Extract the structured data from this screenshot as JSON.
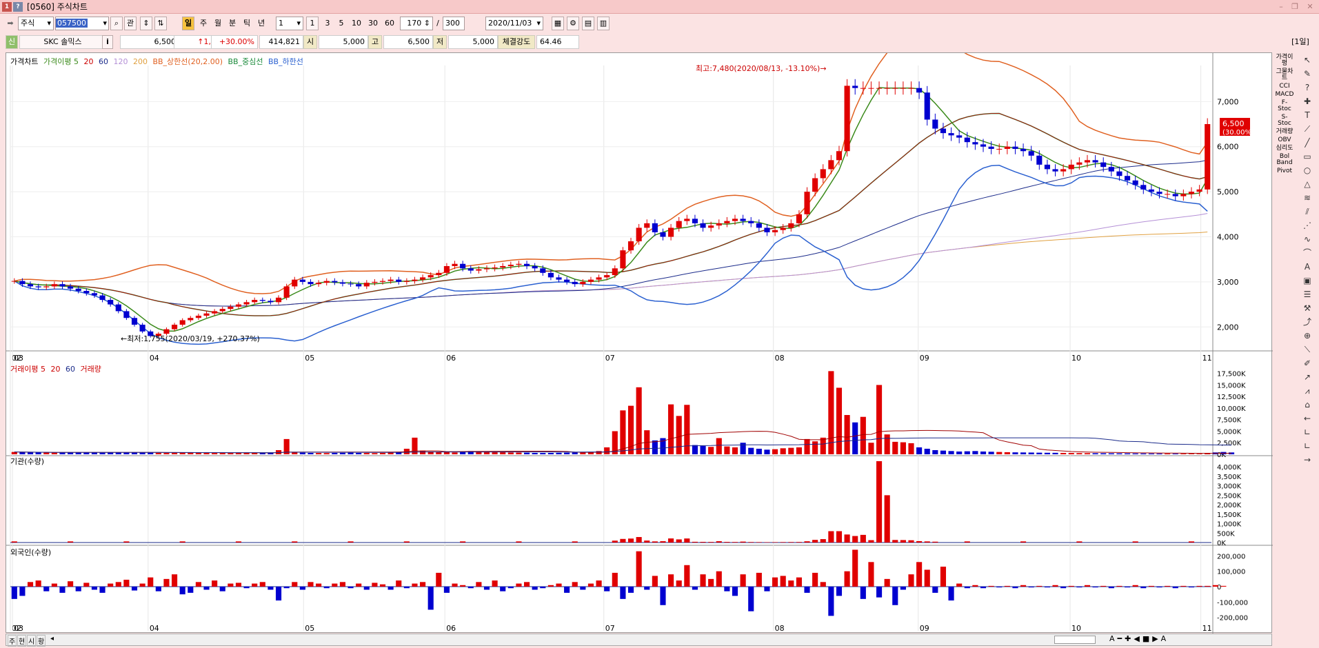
{
  "window": {
    "title": "[0560] 주식차트",
    "min": "–",
    "restore": "❐",
    "close": "✕"
  },
  "toolbar": {
    "market": "주식",
    "code": "057500",
    "gwan": "관",
    "search_icon": "magnifier-icon",
    "periods": [
      "일",
      "주",
      "월",
      "분",
      "틱",
      "년"
    ],
    "period_count": "1",
    "nums": [
      "1",
      "3",
      "5",
      "10",
      "30",
      "60"
    ],
    "display_count": "170",
    "total_count": "300",
    "date": "2020/11/03"
  },
  "quote": {
    "tag": "신",
    "name": "SKC 솔믹스",
    "info": "i",
    "price": "6,500",
    "change": "↑1,500",
    "rate": "+30.00%",
    "volume": "414,821",
    "open_label": "시",
    "open": "5,000",
    "high_label": "고",
    "high": "6,500",
    "low_label": "저",
    "low": "5,000",
    "strength_label": "체결강도",
    "strength": "64.46",
    "frame": "[1일]"
  },
  "legends": {
    "price": [
      "가격차트",
      "가격이평 5",
      "20",
      "60",
      "120",
      "200",
      "BB_상한선(20,2.00)",
      "BB_중심선",
      "BB_하한선"
    ],
    "volume": [
      "거래이평 5",
      "20",
      "60",
      "거래량"
    ],
    "inst": "기관(수량)",
    "foreign": "외국인(수량)"
  },
  "annotations": {
    "high": "최고:7,480(2020/08/13, -13.10%)",
    "low": "최저:1,755(2020/03/19, +270.37%)",
    "last_price": "6,500",
    "last_rate": "(30.00%)"
  },
  "chart_data": {
    "type": "candlestick",
    "x_ticks": [
      "02",
      "03",
      "04",
      "05",
      "06",
      "07",
      "08",
      "09",
      "10",
      "11"
    ],
    "price_axis": [
      "7,000",
      "6,000",
      "5,000",
      "4,000",
      "3,000",
      "2,000"
    ],
    "volume_axis": [
      "17,500K",
      "15,000K",
      "12,500K",
      "10,000K",
      "7,500K",
      "5,000K",
      "2,500K",
      "0K"
    ],
    "inst_axis": [
      "4,000K",
      "3,500K",
      "3,000K",
      "2,500K",
      "2,000K",
      "1,500K",
      "1,000K",
      "500K",
      "0K"
    ],
    "foreign_axis": [
      "200,000",
      "100,000",
      "0",
      "-100,000",
      "-200,000"
    ],
    "ylim_price": [
      1500,
      7800
    ],
    "closes": [
      3020,
      2950,
      2900,
      2880,
      2900,
      2950,
      2900,
      2850,
      2800,
      2750,
      2700,
      2600,
      2500,
      2350,
      2200,
      2050,
      1900,
      1800,
      1850,
      1950,
      2050,
      2150,
      2200,
      2250,
      2300,
      2350,
      2400,
      2450,
      2500,
      2550,
      2600,
      2580,
      2550,
      2650,
      2900,
      3050,
      3000,
      2950,
      2980,
      3020,
      2990,
      2960,
      2950,
      2900,
      2980,
      3000,
      3020,
      3050,
      3000,
      3020,
      3050,
      3100,
      3150,
      3200,
      3350,
      3400,
      3300,
      3250,
      3280,
      3300,
      3320,
      3350,
      3380,
      3400,
      3350,
      3300,
      3200,
      3100,
      3050,
      3000,
      2950,
      3000,
      3050,
      3100,
      3150,
      3300,
      3700,
      3900,
      4200,
      4300,
      4100,
      4000,
      4200,
      4350,
      4400,
      4300,
      4200,
      4250,
      4300,
      4350,
      4400,
      4350,
      4300,
      4200,
      4100,
      4150,
      4200,
      4300,
      4500,
      5000,
      5300,
      5500,
      5700,
      5900,
      7350,
      7300,
      7300,
      7300,
      7300,
      7300,
      7300,
      7300,
      7300,
      7200,
      6600,
      6400,
      6300,
      6250,
      6200,
      6100,
      6050,
      6000,
      5950,
      5950,
      6000,
      5950,
      5900,
      5800,
      5600,
      5500,
      5450,
      5500,
      5600,
      5650,
      5700,
      5650,
      5550,
      5450,
      5350,
      5250,
      5150,
      5050,
      5000,
      4950,
      4950,
      4900,
      4950,
      5000,
      5050,
      6500
    ],
    "volumes": [
      500,
      450,
      420,
      400,
      380,
      350,
      400,
      420,
      450,
      400,
      380,
      350,
      400,
      380,
      420,
      400,
      380,
      350,
      300,
      280,
      300,
      320,
      350,
      300,
      280,
      270,
      260,
      250,
      260,
      280,
      300,
      320,
      350,
      900,
      3300,
      400,
      350,
      300,
      280,
      260,
      300,
      320,
      350,
      300,
      280,
      260,
      300,
      400,
      500,
      1200,
      3600,
      800,
      600,
      500,
      450,
      400,
      500,
      700,
      600,
      550,
      500,
      450,
      400,
      380,
      350,
      300,
      280,
      300,
      320,
      350,
      400,
      450,
      500,
      700,
      1500,
      5000,
      9500,
      10500,
      14500,
      5200,
      3000,
      3500,
      10800,
      8300,
      10700,
      2000,
      1800,
      1600,
      3500,
      1700,
      1500,
      2500,
      1400,
      1200,
      1000,
      1100,
      1300,
      1400,
      1500,
      3300,
      2800,
      3600,
      18000,
      14400,
      8500,
      6900,
      8100,
      2500,
      15000,
      4300,
      2700,
      2600,
      2400,
      1500,
      1200,
      900,
      800,
      700,
      600,
      650,
      700,
      600,
      550,
      500,
      450,
      420,
      400,
      380,
      350,
      330,
      320,
      300,
      280,
      260,
      250,
      240,
      230,
      220,
      210,
      200,
      190,
      180,
      170,
      160,
      150,
      140,
      130,
      120,
      110,
      300,
      400,
      500,
      400
    ],
    "inst": [
      0,
      0,
      0,
      0,
      0,
      0,
      0,
      0,
      0,
      0,
      0,
      0,
      0,
      0,
      0,
      0,
      0,
      0,
      0,
      0,
      0,
      0,
      0,
      0,
      0,
      0,
      0,
      0,
      0,
      0,
      0,
      0,
      0,
      0,
      0,
      0,
      0,
      0,
      0,
      0,
      0,
      0,
      0,
      0,
      0,
      0,
      0,
      0,
      0,
      0,
      0,
      0,
      0,
      0,
      0,
      0,
      0,
      0,
      0,
      0,
      0,
      0,
      0,
      0,
      0,
      0,
      0,
      0,
      0,
      0,
      0,
      0,
      0,
      0,
      0,
      0,
      0,
      0,
      0,
      0,
      0,
      0,
      0,
      0,
      0,
      0,
      0,
      0,
      0,
      0,
      0,
      0,
      0,
      0,
      0,
      0,
      0,
      0,
      0,
      0,
      0,
      0,
      0,
      0,
      0,
      0,
      0,
      0,
      0,
      0,
      0,
      0,
      0,
      0,
      0,
      0,
      0,
      0,
      0,
      0,
      0,
      0,
      0,
      0,
      0,
      0,
      0,
      0,
      0,
      0,
      0,
      0,
      0,
      0,
      0,
      0,
      0,
      0,
      0,
      0,
      0,
      0,
      0,
      0,
      0,
      0,
      0,
      0,
      0,
      0
    ],
    "foreign": [
      -80000,
      -60000,
      30000,
      40000,
      -30000,
      20000,
      -40000,
      35000,
      -30000,
      25000,
      -20000,
      -40000,
      20000,
      30000,
      45000,
      -25000,
      20000,
      60000,
      -30000,
      50000,
      80000,
      -50000,
      -40000,
      30000,
      -20000,
      40000,
      -30000,
      20000,
      25000,
      -10000,
      20000,
      30000,
      -20000,
      -90000,
      -10000,
      30000,
      -20000,
      30000,
      20000,
      -10000,
      20000,
      30000,
      -10000,
      20000,
      -20000,
      25000,
      15000,
      -20000,
      40000,
      -10000,
      20000,
      30000,
      -150000,
      90000,
      -40000,
      20000,
      10000,
      -10000,
      30000,
      -20000,
      40000,
      -30000,
      -10000,
      20000,
      30000,
      -20000,
      -10000,
      10000,
      20000,
      -40000,
      30000,
      -20000,
      20000,
      40000,
      -30000,
      90000,
      -80000,
      -40000,
      230000,
      -20000,
      70000,
      -120000,
      80000,
      40000,
      140000,
      -20000,
      80000,
      50000,
      100000,
      -30000,
      -60000,
      80000,
      -160000,
      90000,
      -30000,
      60000,
      70000,
      40000,
      60000,
      -40000,
      90000,
      30000,
      -190000,
      -60000,
      100000,
      240000,
      -80000,
      160000,
      -70000,
      50000,
      -120000,
      -20000,
      80000,
      160000,
      110000,
      -40000,
      130000,
      -90000,
      20000,
      -10000,
      10000,
      -10000,
      5000,
      -5000,
      5000,
      -10000,
      10000,
      -5000,
      5000,
      -5000,
      10000,
      -10000,
      5000,
      -5000,
      10000,
      -5000,
      5000,
      -10000,
      5000,
      -5000,
      10000,
      -10000,
      5000,
      -5000,
      5000,
      -10000,
      5000,
      -5000,
      5000,
      5000,
      10000,
      5000
    ]
  },
  "statusbar": {
    "tabs": [
      "주",
      "현",
      "시",
      "황"
    ]
  },
  "rightbar": {
    "items": [
      "가격이평",
      "그물차트",
      "CCI",
      "MACD",
      "F-Stoc",
      "S-Stoc",
      "거래량",
      "OBV",
      "심리도",
      "Bol Band",
      "Pivot"
    ]
  }
}
